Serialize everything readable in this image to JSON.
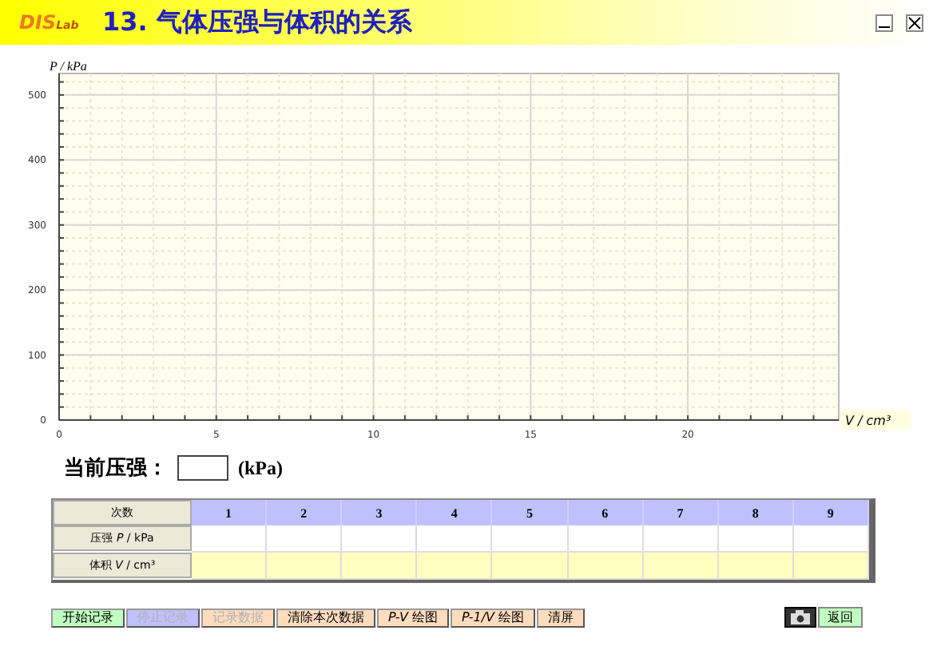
{
  "header": {
    "logo_text": "DIS",
    "logo_sub": "Lab",
    "title": "13. 气体压强与体积的关系"
  },
  "chart": {
    "chart_data": {
      "type": "line",
      "grid": true,
      "xlabel": "V / cm³",
      "ylabel": "P / kPa",
      "xlim": [
        0,
        24.8
      ],
      "ylim": [
        0,
        533
      ],
      "xticks": [
        0,
        5,
        10,
        15,
        20
      ],
      "yticks": [
        0,
        100,
        200,
        300,
        400,
        500
      ]
    }
  },
  "current_pressure": {
    "label": "当前压强：",
    "unit": "(kPa)"
  },
  "table": {
    "header_label": "次数",
    "columns": [
      "1",
      "2",
      "3",
      "4",
      "5",
      "6",
      "7",
      "8",
      "9"
    ],
    "rows": [
      {
        "label": "压强 *P* / kPa",
        "color": "#ffffff"
      },
      {
        "label": "体积 *V* / cm³",
        "color": "#ffffc0"
      }
    ]
  },
  "buttons": [
    {
      "label": "开始记录",
      "color": "#c0ffc0",
      "disabled": false
    },
    {
      "label": "停止记录",
      "color": "#c0c0ff",
      "disabled": true
    },
    {
      "label": "记录数据",
      "color": "#ffdcbe",
      "disabled": true
    },
    {
      "label": "清除本次数据",
      "color": "#ffdcbe",
      "disabled": false
    },
    {
      "label": "*P-V* 绘图",
      "color": "#ffdcbe",
      "disabled": false
    },
    {
      "label": "*P-1/V* 绘图",
      "color": "#ffdcbe",
      "disabled": false
    },
    {
      "label": "清屏",
      "color": "#ffdcbe",
      "disabled": false
    }
  ],
  "return_button": {
    "label": "返回"
  }
}
